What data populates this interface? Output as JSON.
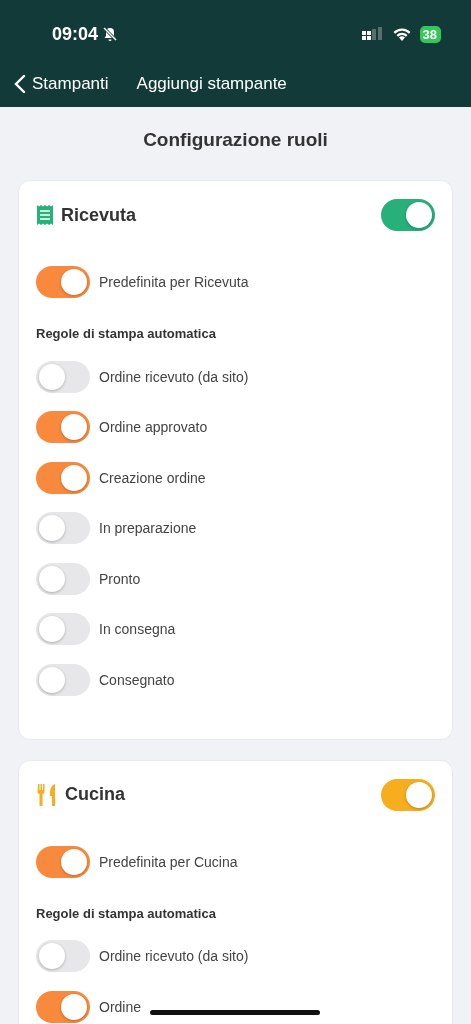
{
  "status_bar": {
    "time": "09:04",
    "battery": "38"
  },
  "nav": {
    "back_label": "Stampanti",
    "title": "Aggiungi stampante"
  },
  "page_title": "Configurazione ruoli",
  "roles": [
    {
      "kind": "receipt",
      "name": "Ricevuta",
      "color": "#27b07a",
      "on": true,
      "default_label": "Predefinita per Ricevuta",
      "default_on": true,
      "rules_title": "Regole di stampa automatica",
      "rules": [
        {
          "label": "Ordine ricevuto (da sito)",
          "on": false
        },
        {
          "label": "Ordine approvato",
          "on": true
        },
        {
          "label": "Creazione ordine",
          "on": true
        },
        {
          "label": "In preparazione",
          "on": false
        },
        {
          "label": "Pronto",
          "on": false
        },
        {
          "label": "In consegna",
          "on": false
        },
        {
          "label": "Consegnato",
          "on": false
        }
      ]
    },
    {
      "kind": "kitchen",
      "name": "Cucina",
      "color": "#f7ae1e",
      "on": true,
      "default_label": "Predefinita per Cucina",
      "default_on": true,
      "rules_title": "Regole di stampa automatica",
      "rules": [
        {
          "label": "Ordine ricevuto (da sito)",
          "on": false
        },
        {
          "label": "Ordine",
          "on": true
        }
      ]
    }
  ]
}
